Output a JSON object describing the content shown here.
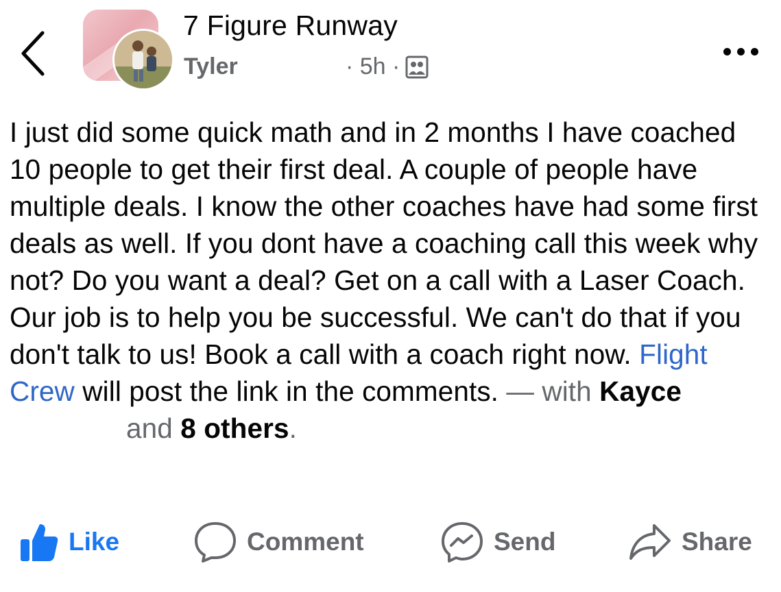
{
  "header": {
    "group_name": "7 Figure Runway",
    "author": "Tyler",
    "time": "· 5h ·",
    "audience_icon": "group-audience-icon",
    "back_icon": "chevron-left-icon",
    "more_icon": "more-horizontal-icon"
  },
  "post": {
    "text": "I just did some quick math and in 2 months I have coached 10 people to get their first deal. A couple of people have multiple deals. I know the other coaches have had some first deals as well. If you dont have a coaching call this week why not? Do you want a deal? Get on a call with a Laser Coach. Our job is to help you be successful. We can't do that if you don't talk to us! Book a call with a coach right now.",
    "mention": "Flight Crew",
    "after_mention": "will post the link in the comments.",
    "with_text": "— with",
    "tagged_name": "Kayce",
    "and_text": "and",
    "others": "8 others",
    "period": ".",
    "link_color": "#2e67c7"
  },
  "actions": {
    "like": "Like",
    "comment": "Comment",
    "send": "Send",
    "share": "Share",
    "like_color": "#1877f2"
  }
}
